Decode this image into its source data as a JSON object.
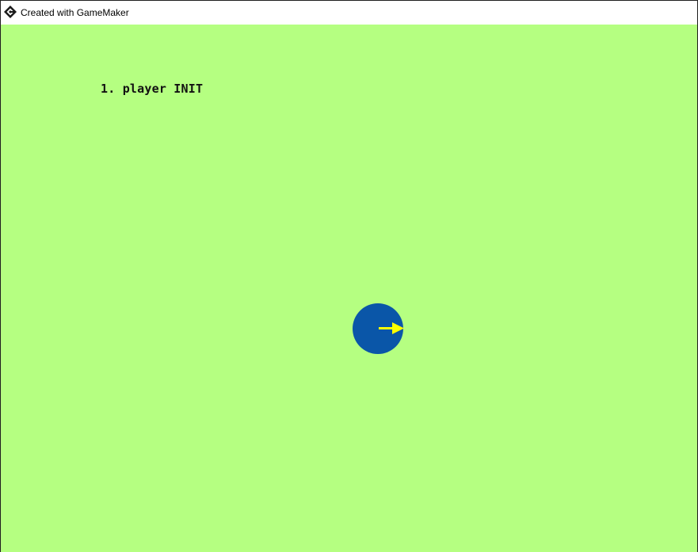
{
  "window": {
    "title": "Created with GameMaker",
    "icon": "gamemaker-logo-icon"
  },
  "game": {
    "background_color": "#b5ff81",
    "debug_text": "1. player INIT",
    "player": {
      "body_color": "#0a56a8",
      "direction_arrow_color": "#ffff00",
      "facing": "right"
    }
  }
}
